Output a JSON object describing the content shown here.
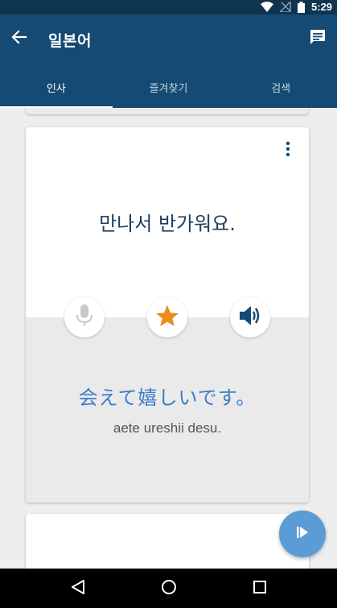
{
  "status_bar": {
    "time": "5:29"
  },
  "header": {
    "title": "일본어"
  },
  "tabs": [
    {
      "label": "인사",
      "active": true
    },
    {
      "label": "즐겨찾기",
      "active": false
    },
    {
      "label": "검색",
      "active": false
    }
  ],
  "card": {
    "korean": "만나서 반가워요.",
    "japanese": "会えて嬉しいです。",
    "romaji": "aete ureshii desu.",
    "favorited": true
  },
  "icons": {
    "back": "arrow-back-icon",
    "chat": "chat-icon",
    "more": "more-vert-icon",
    "mic": "mic-icon",
    "star": "star-icon",
    "speaker": "speaker-icon",
    "play": "play-icon"
  },
  "colors": {
    "app_bar": "#144a73",
    "status_bar": "#0f3450",
    "star": "#f0891e",
    "japanese_text": "#3d7cc6",
    "fab": "#5b9bd6"
  }
}
